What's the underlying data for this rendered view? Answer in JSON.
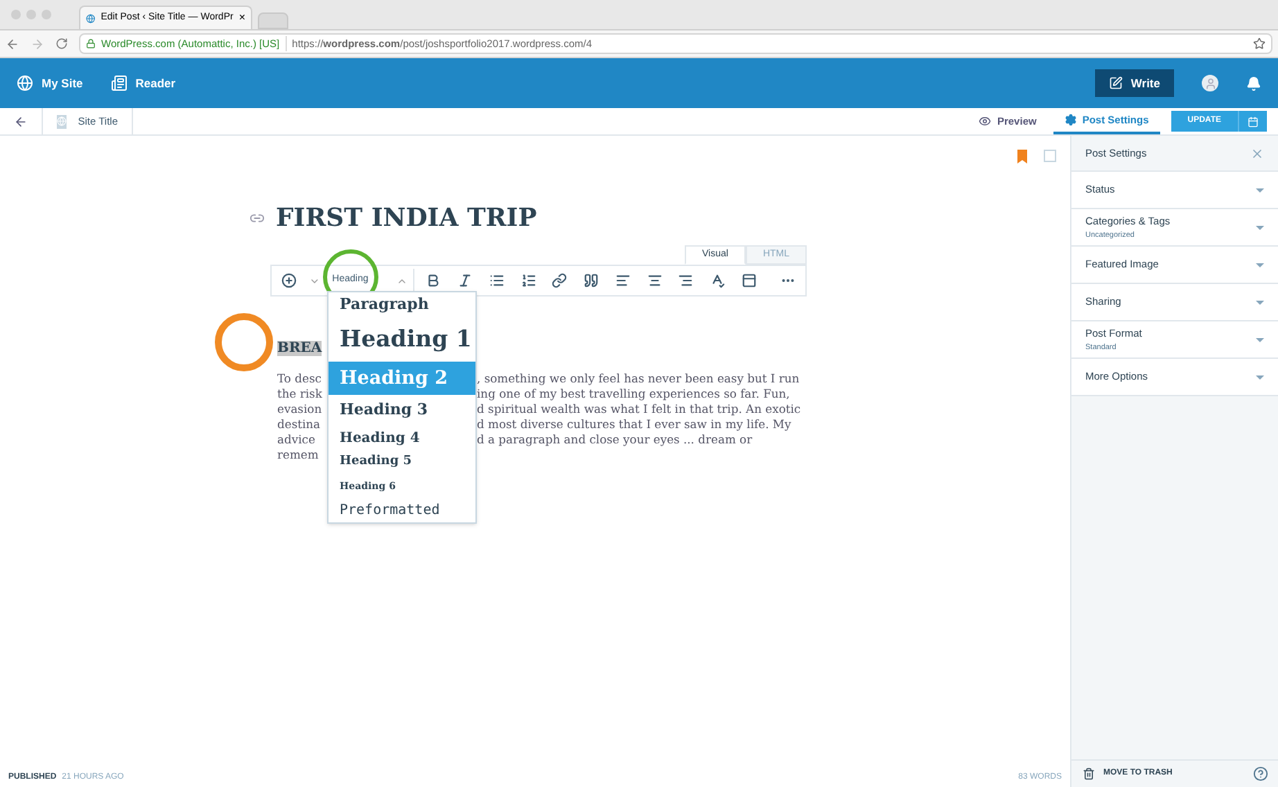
{
  "browser": {
    "tab_title": "Edit Post ‹ Site Title — WordPr",
    "tab_close": "×",
    "site_identity": "WordPress.com (Automattic, Inc.) [US]",
    "url": "https://**wordpress.com**/post/joshsportfolio2017.wordpress.com/4"
  },
  "masterbar": {
    "items": [
      {
        "label": "My Site",
        "kind": "site"
      },
      {
        "label": "Reader",
        "kind": "reader"
      }
    ],
    "write": "Write"
  },
  "editor_header": {
    "site_title": "Site Title",
    "preview": "Preview",
    "post_settings": {
      "label": "Post Settings",
      "selected": true
    },
    "update": "UPDATE"
  },
  "post": {
    "title": "FIRST INDIA TRIP",
    "tabs": [
      {
        "label": "Visual",
        "selected": true
      },
      {
        "label": "HTML",
        "selected": false
      }
    ],
    "format_select": "Heading",
    "format_options": [
      {
        "label": "Paragraph",
        "kind": "paragraph",
        "selected": false
      },
      {
        "label": "Heading 1",
        "kind": "h1",
        "selected": false
      },
      {
        "label": "Heading 2",
        "kind": "h2",
        "selected": true
      },
      {
        "label": "Heading 3",
        "kind": "h3",
        "selected": false
      },
      {
        "label": "Heading 4",
        "kind": "h4",
        "selected": false
      },
      {
        "label": "Heading 5",
        "kind": "h5",
        "selected": false
      },
      {
        "label": "Heading 6",
        "kind": "h6",
        "selected": false
      },
      {
        "label": "Preformatted",
        "kind": "pre",
        "selected": false
      }
    ],
    "heading": {
      "text": "BREA",
      "selected": true
    },
    "body_lines": [
      {
        "left": "To desc",
        "right": ", something we only feel has never been easy but I run"
      },
      {
        "left": "the risk",
        "right": "ing one of my best travelling experiences so far. Fun,"
      },
      {
        "left": "evasion",
        "right": "d spiritual wealth was what I felt in that trip. An exotic"
      },
      {
        "left": "destina",
        "right": "d most diverse cultures that I ever saw in my life. My"
      },
      {
        "left": "advice",
        "right": "d a paragraph and close your eyes ... dream or"
      },
      {
        "left": "remem"
      }
    ]
  },
  "sidebar": {
    "title": "Post Settings",
    "sections": [
      {
        "label": "Status"
      },
      {
        "label": "Categories & Tags",
        "value": "Uncategorized"
      },
      {
        "label": "Featured Image"
      },
      {
        "label": "Sharing"
      },
      {
        "label": "Post Format",
        "value": "Standard"
      },
      {
        "label": "More Options"
      }
    ]
  },
  "footer": {
    "published_label": "PUBLISHED",
    "published_time": "21 HOURS AGO",
    "word_count": "83 WORDS",
    "trash": "MOVE TO TRASH"
  }
}
